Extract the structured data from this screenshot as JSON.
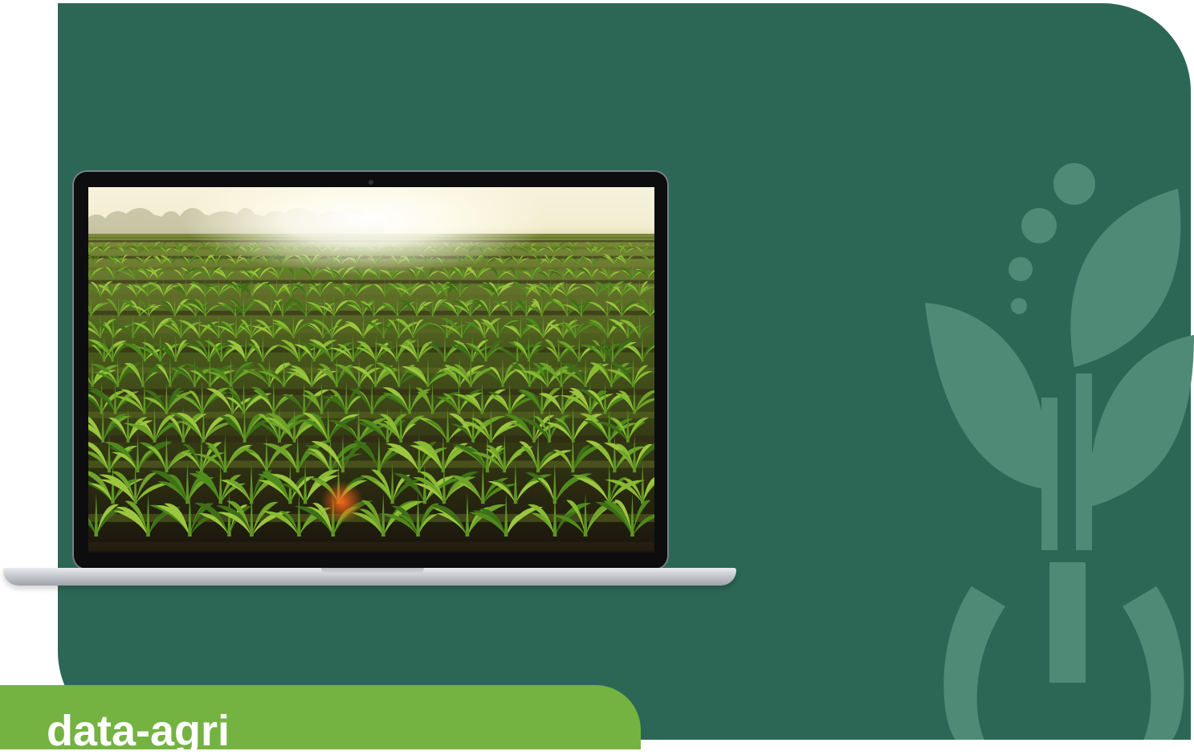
{
  "colors": {
    "panel_bg": "#2c6756",
    "accent_green": "#74b341",
    "logo_tint": "#4f8a77",
    "field_green": "#4b7d22",
    "sky_glow": "#fbf7e4"
  },
  "hero": {
    "device": "laptop",
    "screen_image": "corn-field-sunrise-photo"
  },
  "logo": {
    "icon": "plant-sprout-logo-icon"
  },
  "bottom_banner": {
    "text": "data-agri"
  }
}
